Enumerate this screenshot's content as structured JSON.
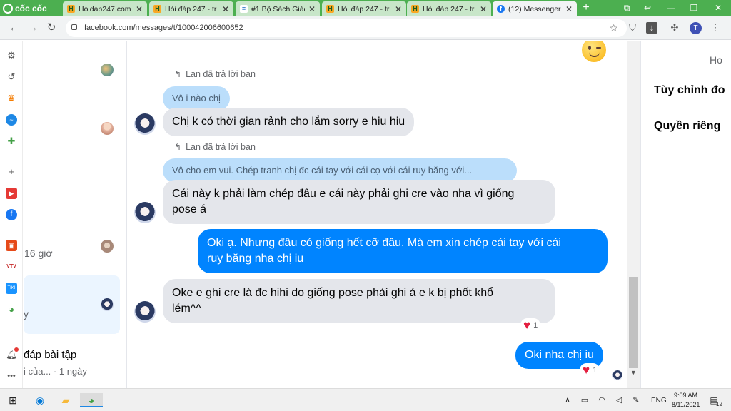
{
  "browser": {
    "brand": "cốc cốc",
    "tabs": [
      {
        "title": "Hoidap247.com - tr",
        "icon": "hoidap-icon"
      },
      {
        "title": "Hỏi đáp 247 - tr",
        "icon": "hoidap-icon"
      },
      {
        "title": "#1 Bộ Sách Giáo",
        "icon": "book-icon"
      },
      {
        "title": "Hỏi đáp 247 - tr",
        "icon": "hoidap-icon"
      },
      {
        "title": "Hỏi đáp 247 - tr",
        "icon": "hoidap-icon"
      },
      {
        "title": "(12) Messenger",
        "icon": "facebook-icon"
      }
    ],
    "url": "facebook.com/messages/t/100042006600652",
    "profile_initial": "T"
  },
  "chat_list": {
    "time_ago": "16 giờ",
    "selected_snippet": "y",
    "last_item_title": "đáp bài tập",
    "last_item_snippet": "i của... · 1 ngày"
  },
  "conversation": {
    "messages": [
      {
        "reply_note": "Lan đã trả lời bạn",
        "quote": "Vô i nào chị",
        "text": "Chị k có thời gian rảnh cho lắm sorry e hiu hiu"
      },
      {
        "reply_note": "Lan đã trả lời bạn",
        "quote": "Vô cho em vui. Chép tranh chị đc cái tay với cái cọ với cái ruy băng với...",
        "text_line1": "Cái này k phải làm chép đâu e cái này phải ghi cre vào nha vì giống",
        "text_line2": "pose á"
      },
      {
        "text_line1": "Oki ạ. Nhưng đâu có giống hết cỡ đâu. Mà em xin chép cái tay với cái",
        "text_line2": "ruy băng nha chị iu"
      },
      {
        "text_line1": "Oke e ghi cre là đc hihi do giống pose phải ghi á e k bị phốt khổ",
        "text_line2": "lém^^",
        "reaction_count": "1"
      },
      {
        "text": "Oki nha chị iu",
        "reaction_count": "1"
      }
    ]
  },
  "right_panel": {
    "partial_top": "Ho",
    "customize": "Tùy chỉnh đo",
    "privacy": "Quyền riêng"
  },
  "taskbar": {
    "language": "ENG",
    "time": "9:09 AM",
    "date": "8/11/2021",
    "notif_count": "12"
  },
  "colors": {
    "browser_green": "#4CAF50",
    "messenger_blue": "#0084FF",
    "incoming_bubble": "#E4E6EB",
    "heart": "#E41E3F"
  }
}
